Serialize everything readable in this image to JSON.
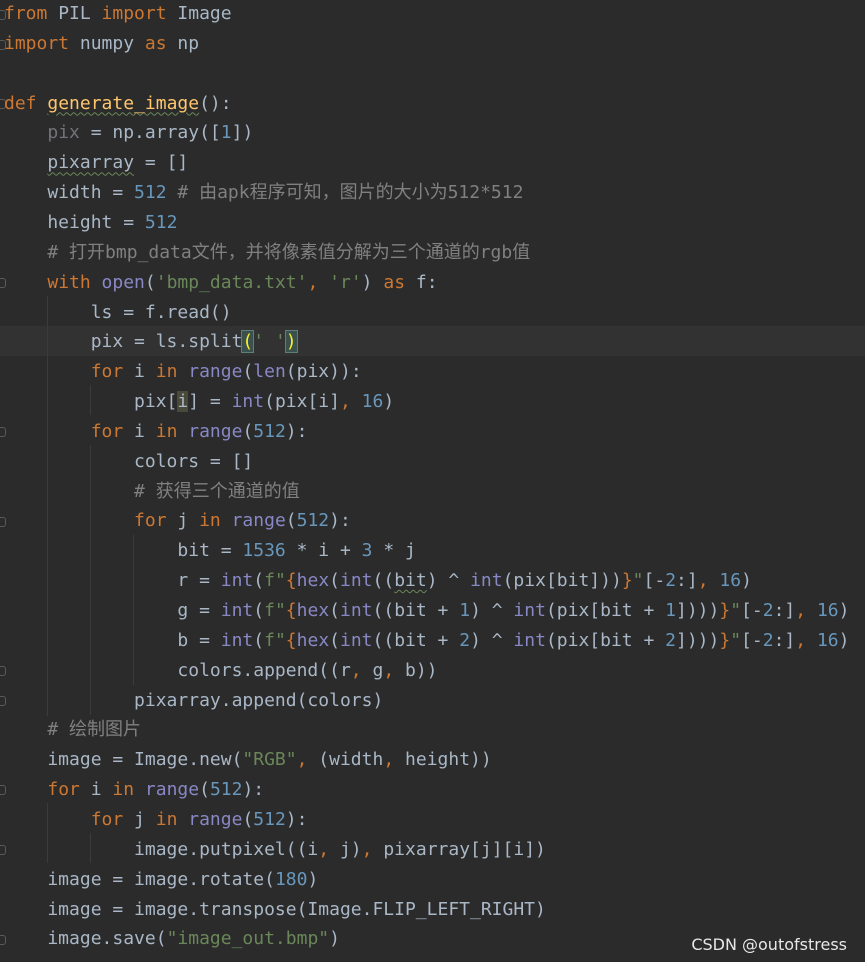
{
  "watermark": "CSDN @outofstress",
  "colors": {
    "background": "#2b2b2b",
    "keyword": "#cc7832",
    "function_def": "#ffc66d",
    "number": "#6897bb",
    "string": "#6a8759",
    "comment": "#808080",
    "builtin": "#8888c6",
    "default": "#a9b7c6"
  },
  "lines": [
    [
      [
        "kw",
        "from"
      ],
      [
        "id",
        " PIL "
      ],
      [
        "kw",
        "import"
      ],
      [
        "id",
        " Image"
      ]
    ],
    [
      [
        "kw",
        "import"
      ],
      [
        "id",
        " numpy "
      ],
      [
        "kw",
        "as"
      ],
      [
        "id",
        " np"
      ]
    ],
    [],
    [
      [
        "kw",
        "def "
      ],
      [
        "fn squig",
        "generate_image"
      ],
      [
        "id",
        "():"
      ]
    ],
    [
      [
        "id",
        "    "
      ],
      [
        "dim",
        "pix"
      ],
      [
        "id",
        " = np.array(["
      ],
      [
        "num",
        "1"
      ],
      [
        "id",
        "])"
      ]
    ],
    [
      [
        "id",
        "    "
      ],
      [
        "id squig",
        "pixarray"
      ],
      [
        "id",
        " = []"
      ]
    ],
    [
      [
        "id",
        "    width = "
      ],
      [
        "num",
        "512"
      ],
      [
        "cm",
        " # 由apk程序可知，图片的大小为512*512"
      ]
    ],
    [
      [
        "id",
        "    height = "
      ],
      [
        "num",
        "512"
      ]
    ],
    [
      [
        "cm",
        "    # 打开bmp_data文件，并将像素值分解为三个通道的rgb值"
      ]
    ],
    [
      [
        "id",
        "    "
      ],
      [
        "kw",
        "with "
      ],
      [
        "bi",
        "open"
      ],
      [
        "id",
        "("
      ],
      [
        "str",
        "'bmp_data.txt'"
      ],
      [
        "kw",
        ", "
      ],
      [
        "str",
        "'r'"
      ],
      [
        "id",
        ") "
      ],
      [
        "kw",
        "as"
      ],
      [
        "id",
        " f:"
      ]
    ],
    [
      [
        "id",
        "        ls = f.read()"
      ]
    ],
    [
      [
        "id",
        "        pix = ls.split"
      ],
      [
        "bracket-match",
        "("
      ],
      [
        "str",
        "' '"
      ],
      [
        "bracket-match",
        ")"
      ]
    ],
    [
      [
        "id",
        "        "
      ],
      [
        "kw",
        "for"
      ],
      [
        "id",
        " i "
      ],
      [
        "kw",
        "in "
      ],
      [
        "bi",
        "range"
      ],
      [
        "id",
        "("
      ],
      [
        "bi",
        "len"
      ],
      [
        "id",
        "(pix)):"
      ]
    ],
    [
      [
        "id",
        "            pix["
      ],
      [
        "ref-hl",
        "i"
      ],
      [
        "id",
        "] = "
      ],
      [
        "bi",
        "int"
      ],
      [
        "id",
        "(pix[i]"
      ],
      [
        "kw",
        ", "
      ],
      [
        "num",
        "16"
      ],
      [
        "id",
        ")"
      ]
    ],
    [
      [
        "id",
        "        "
      ],
      [
        "kw",
        "for"
      ],
      [
        "id",
        " i "
      ],
      [
        "kw",
        "in "
      ],
      [
        "bi",
        "range"
      ],
      [
        "id",
        "("
      ],
      [
        "num",
        "512"
      ],
      [
        "id",
        "):"
      ]
    ],
    [
      [
        "id",
        "            colors = []"
      ]
    ],
    [
      [
        "cm",
        "            # 获得三个通道的值"
      ]
    ],
    [
      [
        "id",
        "            "
      ],
      [
        "kw",
        "for"
      ],
      [
        "id",
        " j "
      ],
      [
        "kw",
        "in "
      ],
      [
        "bi",
        "range"
      ],
      [
        "id",
        "("
      ],
      [
        "num",
        "512"
      ],
      [
        "id",
        "):"
      ]
    ],
    [
      [
        "id",
        "                bit = "
      ],
      [
        "num",
        "1536"
      ],
      [
        "id",
        " * i + "
      ],
      [
        "num",
        "3"
      ],
      [
        "id",
        " * j"
      ]
    ],
    [
      [
        "id",
        "                r = "
      ],
      [
        "bi",
        "int"
      ],
      [
        "id",
        "("
      ],
      [
        "str",
        "f\""
      ],
      [
        "brace",
        "{"
      ],
      [
        "bi",
        "hex"
      ],
      [
        "id",
        "("
      ],
      [
        "bi",
        "int"
      ],
      [
        "id",
        "(("
      ],
      [
        "id squig",
        "bit"
      ],
      [
        "id",
        ") ^ "
      ],
      [
        "bi",
        "int"
      ],
      [
        "id",
        "(pix[bit]))"
      ],
      [
        "brace",
        "}"
      ],
      [
        "str",
        "\""
      ],
      [
        "id",
        "[-"
      ],
      [
        "num",
        "2"
      ],
      [
        "id",
        ":]"
      ],
      [
        "kw",
        ", "
      ],
      [
        "num",
        "16"
      ],
      [
        "id",
        ")"
      ]
    ],
    [
      [
        "id",
        "                g = "
      ],
      [
        "bi",
        "int"
      ],
      [
        "id",
        "("
      ],
      [
        "str",
        "f\""
      ],
      [
        "brace",
        "{"
      ],
      [
        "bi",
        "hex"
      ],
      [
        "id",
        "("
      ],
      [
        "bi",
        "int"
      ],
      [
        "id",
        "((bit + "
      ],
      [
        "num",
        "1"
      ],
      [
        "id",
        ") ^ "
      ],
      [
        "bi",
        "int"
      ],
      [
        "id",
        "(pix[bit + "
      ],
      [
        "num",
        "1"
      ],
      [
        "id",
        "])))"
      ],
      [
        "brace",
        "}"
      ],
      [
        "str",
        "\""
      ],
      [
        "id",
        "[-"
      ],
      [
        "num",
        "2"
      ],
      [
        "id",
        ":]"
      ],
      [
        "kw",
        ", "
      ],
      [
        "num",
        "16"
      ],
      [
        "id",
        ")"
      ]
    ],
    [
      [
        "id",
        "                b = "
      ],
      [
        "bi",
        "int"
      ],
      [
        "id",
        "("
      ],
      [
        "str",
        "f\""
      ],
      [
        "brace",
        "{"
      ],
      [
        "bi",
        "hex"
      ],
      [
        "id",
        "("
      ],
      [
        "bi",
        "int"
      ],
      [
        "id",
        "((bit + "
      ],
      [
        "num",
        "2"
      ],
      [
        "id",
        ") ^ "
      ],
      [
        "bi",
        "int"
      ],
      [
        "id",
        "(pix[bit + "
      ],
      [
        "num",
        "2"
      ],
      [
        "id",
        "])))"
      ],
      [
        "brace",
        "}"
      ],
      [
        "str",
        "\""
      ],
      [
        "id",
        "[-"
      ],
      [
        "num",
        "2"
      ],
      [
        "id",
        ":]"
      ],
      [
        "kw",
        ", "
      ],
      [
        "num",
        "16"
      ],
      [
        "id",
        ")"
      ]
    ],
    [
      [
        "id",
        "                colors.append((r"
      ],
      [
        "kw",
        ", "
      ],
      [
        "id",
        "g"
      ],
      [
        "kw",
        ", "
      ],
      [
        "id",
        "b))"
      ]
    ],
    [
      [
        "id",
        "            pixarray.append(colors)"
      ]
    ],
    [
      [
        "cm",
        "    # 绘制图片"
      ]
    ],
    [
      [
        "id",
        "    image = Image.new("
      ],
      [
        "str",
        "\"RGB\""
      ],
      [
        "kw",
        ", "
      ],
      [
        "id",
        "(width"
      ],
      [
        "kw",
        ", "
      ],
      [
        "id",
        "height))"
      ]
    ],
    [
      [
        "id",
        "    "
      ],
      [
        "kw",
        "for"
      ],
      [
        "id",
        " i "
      ],
      [
        "kw",
        "in "
      ],
      [
        "bi",
        "range"
      ],
      [
        "id",
        "("
      ],
      [
        "num",
        "512"
      ],
      [
        "id",
        "):"
      ]
    ],
    [
      [
        "id",
        "        "
      ],
      [
        "kw",
        "for"
      ],
      [
        "id",
        " j "
      ],
      [
        "kw",
        "in "
      ],
      [
        "bi",
        "range"
      ],
      [
        "id",
        "("
      ],
      [
        "num",
        "512"
      ],
      [
        "id",
        "):"
      ]
    ],
    [
      [
        "id",
        "            image.putpixel((i"
      ],
      [
        "kw",
        ", "
      ],
      [
        "id",
        "j)"
      ],
      [
        "kw",
        ", "
      ],
      [
        "id",
        "pixarray[j][i])"
      ]
    ],
    [
      [
        "id",
        "    image = image.rotate("
      ],
      [
        "num",
        "180"
      ],
      [
        "id",
        ")"
      ]
    ],
    [
      [
        "id",
        "    image = image.transpose(Image.FLIP_LEFT_RIGHT)"
      ]
    ],
    [
      [
        "id",
        "    image.save("
      ],
      [
        "str",
        "\"image_out.bmp\""
      ],
      [
        "id",
        ")"
      ]
    ]
  ]
}
